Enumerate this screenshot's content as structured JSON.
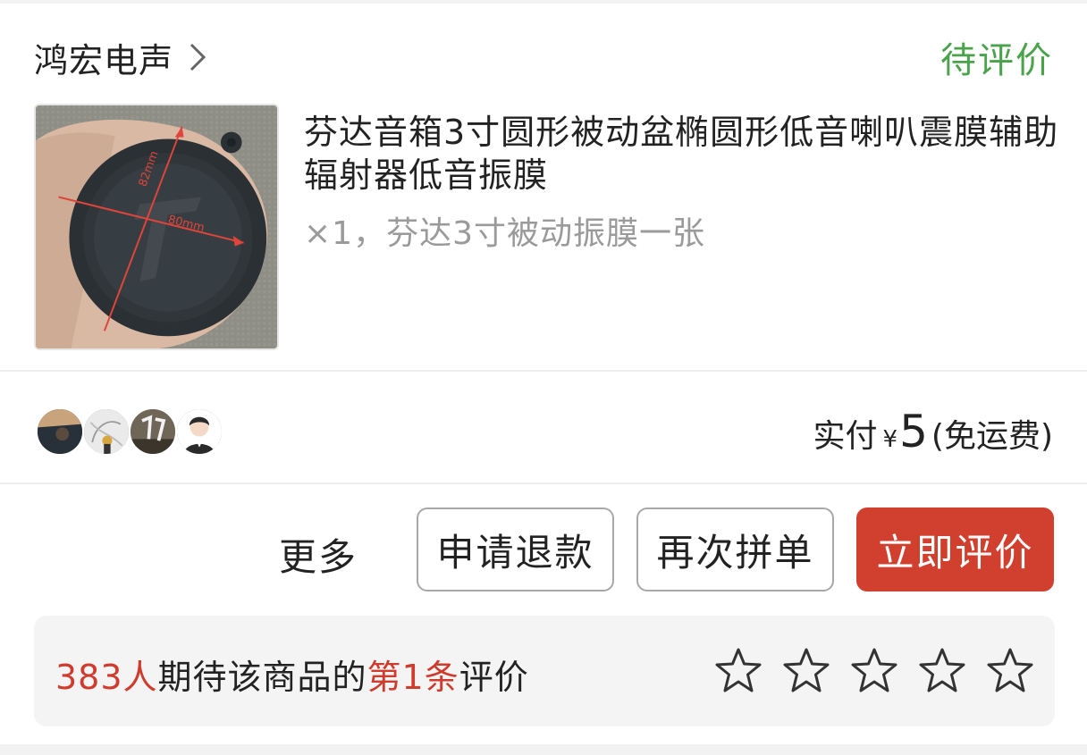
{
  "shop": {
    "name": "鸿宏电声",
    "status": "待评价"
  },
  "product": {
    "title": "芬达音箱3寸圆形被动盆椭圆形低音喇叭震膜辅助辐射器低音振膜",
    "spec": "×1，芬达3寸被动振膜一张",
    "image_labels": {
      "height": "82mm",
      "width": "80mm"
    }
  },
  "payment": {
    "label": "实付",
    "currency": "¥",
    "amount": "5",
    "shipping": "(免运费)"
  },
  "actions": {
    "more": "更多",
    "refund": "申请退款",
    "regroup": "再次拼单",
    "review": "立即评价"
  },
  "review_banner": {
    "count": "383人",
    "text_mid": "期待该商品的",
    "rank": "第1条",
    "text_end": "评价",
    "stars": [
      false,
      false,
      false,
      false,
      false
    ]
  },
  "colors": {
    "status_green": "#4aa34a",
    "accent_red": "#d1402f",
    "highlight_red": "#cf3b2c"
  }
}
